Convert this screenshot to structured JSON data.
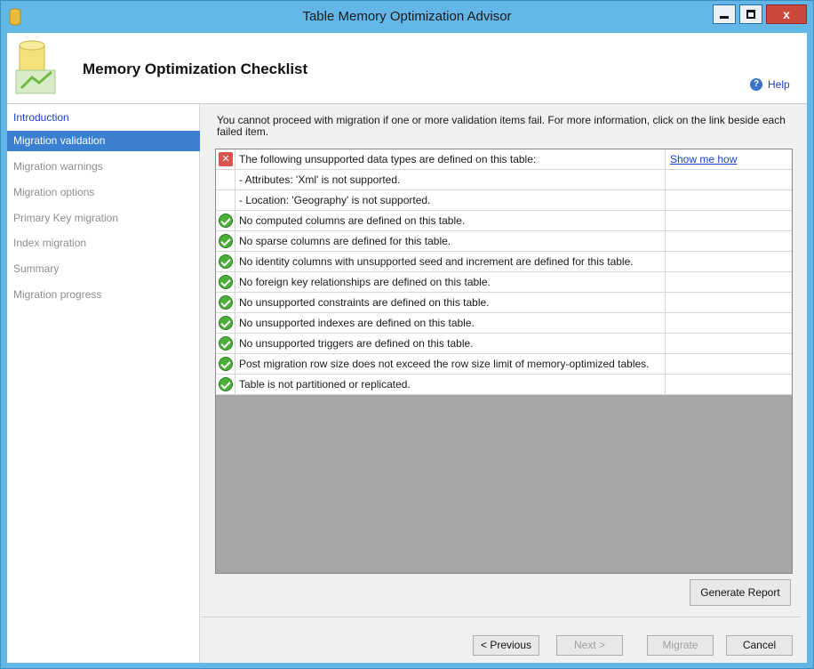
{
  "window": {
    "title": "Table Memory Optimization Advisor"
  },
  "banner": {
    "title": "Memory Optimization Checklist"
  },
  "sidebar": {
    "items": [
      {
        "label": "Introduction",
        "state": "link"
      },
      {
        "label": "Migration validation",
        "state": "active"
      },
      {
        "label": "Migration warnings",
        "state": "disabled"
      },
      {
        "label": "Migration options",
        "state": "disabled"
      },
      {
        "label": "Primary Key migration",
        "state": "disabled"
      },
      {
        "label": "Index migration",
        "state": "disabled"
      },
      {
        "label": "Summary",
        "state": "disabled"
      },
      {
        "label": "Migration progress",
        "state": "disabled"
      }
    ]
  },
  "help": {
    "label": "Help",
    "icon": "help-icon"
  },
  "intro_text": "You cannot proceed with migration if one or more validation items fail. For more information, click on the link beside each failed item.",
  "checklist": [
    {
      "status": "error",
      "text": "The following unsupported data types are defined on this table:",
      "link": "Show me how"
    },
    {
      "status": "none",
      "text": "- Attributes: 'Xml' is not supported.",
      "link": ""
    },
    {
      "status": "none",
      "text": "- Location: 'Geography' is not supported.",
      "link": ""
    },
    {
      "status": "ok",
      "text": "No computed columns are defined on this table.",
      "link": ""
    },
    {
      "status": "ok",
      "text": "No sparse columns are defined for this table.",
      "link": ""
    },
    {
      "status": "ok",
      "text": "No identity columns with unsupported seed and increment are defined for this table.",
      "link": ""
    },
    {
      "status": "ok",
      "text": "No foreign key relationships are defined on this table.",
      "link": ""
    },
    {
      "status": "ok",
      "text": "No unsupported constraints are defined on this table.",
      "link": ""
    },
    {
      "status": "ok",
      "text": "No unsupported indexes are defined on this table.",
      "link": ""
    },
    {
      "status": "ok",
      "text": "No unsupported triggers are defined on this table.",
      "link": ""
    },
    {
      "status": "ok",
      "text": "Post migration row size does not exceed the row size limit of memory-optimized tables.",
      "link": ""
    },
    {
      "status": "ok",
      "text": "Table is not partitioned or replicated.",
      "link": ""
    }
  ],
  "buttons": {
    "generate_report": "Generate Report",
    "previous": "< Previous",
    "next": "Next >",
    "migrate": "Migrate",
    "cancel": "Cancel"
  },
  "colors": {
    "titlebar": "#62b6e8",
    "active_nav": "#3b7fd0",
    "link": "#1c3fcf",
    "ok": "#4caf3a",
    "error": "#d9534f"
  }
}
